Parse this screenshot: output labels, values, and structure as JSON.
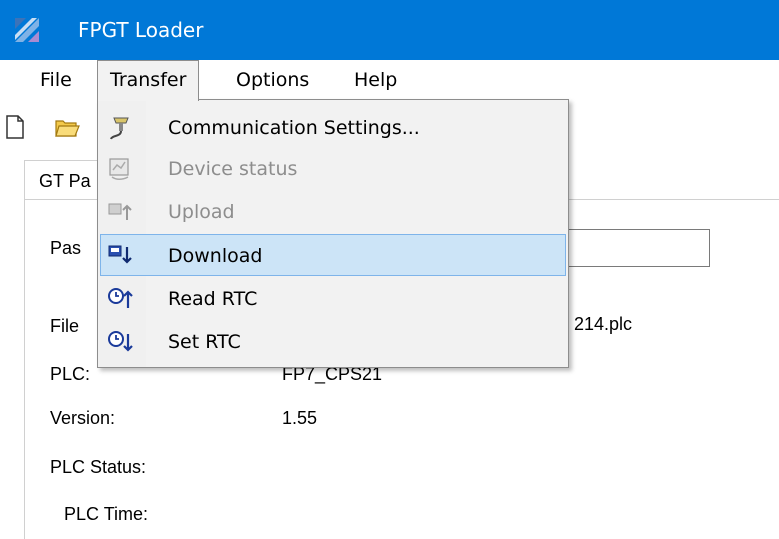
{
  "window": {
    "title": "FPGT Loader"
  },
  "menu": {
    "file": "File",
    "transfer": "Transfer",
    "options": "Options",
    "help": "Help"
  },
  "toolbar": {
    "new_icon": "new-file-icon",
    "open_icon": "open-folder-icon"
  },
  "tabs": {
    "active": "GT Pa"
  },
  "info": {
    "password_label": "Pas",
    "file_label": "File",
    "file_value": "214.plc",
    "plc_label": "PLC:",
    "plc_value": "FP7_CPS21",
    "version_label": "Version:",
    "version_value": "1.55",
    "plc_status_label": "PLC Status:",
    "plc_time_label": "PLC Time:"
  },
  "transfer_menu": {
    "items": [
      {
        "label": "Communication Settings...",
        "icon": "plug-icon",
        "enabled": true
      },
      {
        "label": "Device status",
        "icon": "device-status-icon",
        "enabled": false
      },
      {
        "label": "Upload",
        "icon": "upload-icon",
        "enabled": false
      },
      {
        "label": "Download",
        "icon": "download-icon",
        "enabled": true,
        "highlighted": true
      },
      {
        "label": "Read RTC",
        "icon": "read-rtc-icon",
        "enabled": true
      },
      {
        "label": "Set RTC",
        "icon": "set-rtc-icon",
        "enabled": true
      }
    ]
  },
  "colors": {
    "titlebar": "#0078d7",
    "highlight": "#cce4f7",
    "highlight_border": "#7eb4ea",
    "disabled_text": "#8d8d8d"
  }
}
